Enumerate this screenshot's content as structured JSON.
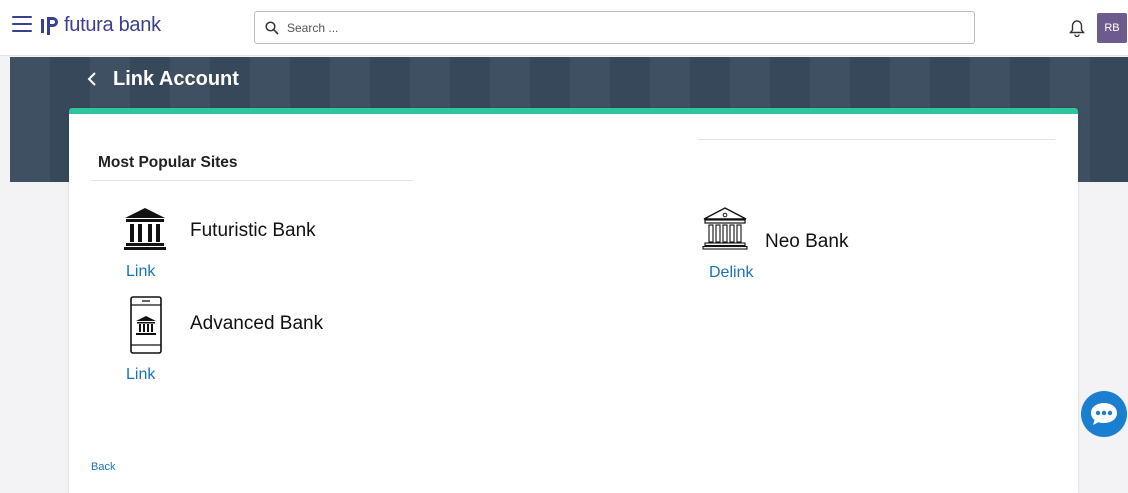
{
  "header": {
    "brand": "futura bank",
    "search_placeholder": "Search ...",
    "avatar_initials": "RB"
  },
  "page": {
    "title": "Link Account"
  },
  "card": {
    "section_title": "Most Popular Sites",
    "banks": [
      {
        "name": "Futuristic Bank",
        "action": "Link",
        "icon": "bank-building-icon"
      },
      {
        "name": "Advanced Bank",
        "action": "Link",
        "icon": "mobile-bank-icon"
      },
      {
        "name": "Neo Bank",
        "action": "Delink",
        "icon": "bank-building-outline-icon"
      }
    ],
    "back_label": "Back"
  },
  "colors": {
    "brand": "#3a3f8f",
    "band": "#384a5d",
    "accent": "#2ec4a1",
    "link": "#1a73b8",
    "avatar": "#6d5a8e",
    "chat": "#1a7fd0"
  }
}
